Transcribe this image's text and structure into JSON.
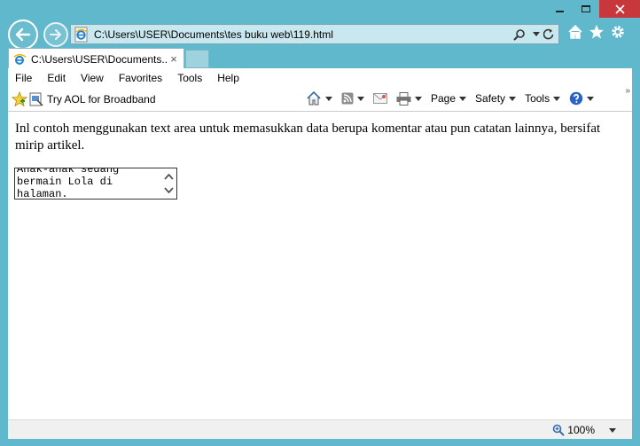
{
  "window": {
    "controls": [
      "minimize",
      "maximize",
      "close"
    ]
  },
  "address_bar": {
    "url": "C:\\Users\\USER\\Documents\\tes buku web\\119.html",
    "icons": [
      "search-icon",
      "dropdown-icon",
      "refresh-icon"
    ]
  },
  "toolbar_icons": [
    "home-icon",
    "star-icon",
    "gear-icon"
  ],
  "tab": {
    "title": "C:\\Users\\USER\\Documents...",
    "close": "×"
  },
  "menu": [
    "File",
    "Edit",
    "View",
    "Favorites",
    "Tools",
    "Help"
  ],
  "favorites_bar": {
    "link": "Try AOL for Broadband"
  },
  "command_bar": {
    "page": "Page",
    "safety": "Safety",
    "tools": "Tools",
    "more": "»"
  },
  "content": {
    "paragraph": "Inl contoh menggunakan text area untuk memasukkan data berupa komentar atau pun catatan lainnya, bersifat mirip artikel.",
    "textarea_value": "Anak-anak sedang bermain Lola di halaman."
  },
  "status": {
    "zoom": "100%"
  },
  "colors": {
    "frame": "#5fb8cb",
    "address_bg": "#c9e7ee",
    "close_button": "#c7383c"
  }
}
